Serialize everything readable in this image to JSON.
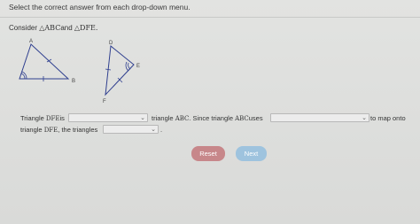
{
  "instruction": "Select the correct answer from each drop-down menu.",
  "consider": {
    "prefix": "Consider ",
    "triangle1": "△ABC",
    "conjunction": "and ",
    "triangle2": "△DFE."
  },
  "figure": {
    "triangle_abc": {
      "A": "A",
      "B": "B",
      "C": "C"
    },
    "triangle_dfe": {
      "D": "D",
      "E": "E",
      "F": "F"
    }
  },
  "question": {
    "part1_prefix": "Triangle ",
    "part1_triangle": "DFE",
    "part1_is": "is",
    "part2_prefix": " triangle ",
    "part2_triangle": "ABC",
    "part2_since": ". Since triangle ",
    "part2_triangle_b": "ABC",
    "part2_uses": "uses",
    "part3": " to map onto",
    "part4_prefix": "triangle ",
    "part4_triangle": "DFE",
    "part4_suffix": ", the triangles",
    "part5": "."
  },
  "dropdowns": {
    "dropdown1": {
      "selected": ""
    },
    "dropdown2": {
      "selected": ""
    },
    "dropdown3": {
      "selected": ""
    }
  },
  "buttons": {
    "reset_label": "Reset",
    "next_label": "Next"
  },
  "colors": {
    "reset_bg": "#c7878a",
    "next_bg": "#9ec3de",
    "page_bg": "#dcdddb"
  },
  "icons": {
    "dropdown_chevron": "chevron-down-icon"
  }
}
